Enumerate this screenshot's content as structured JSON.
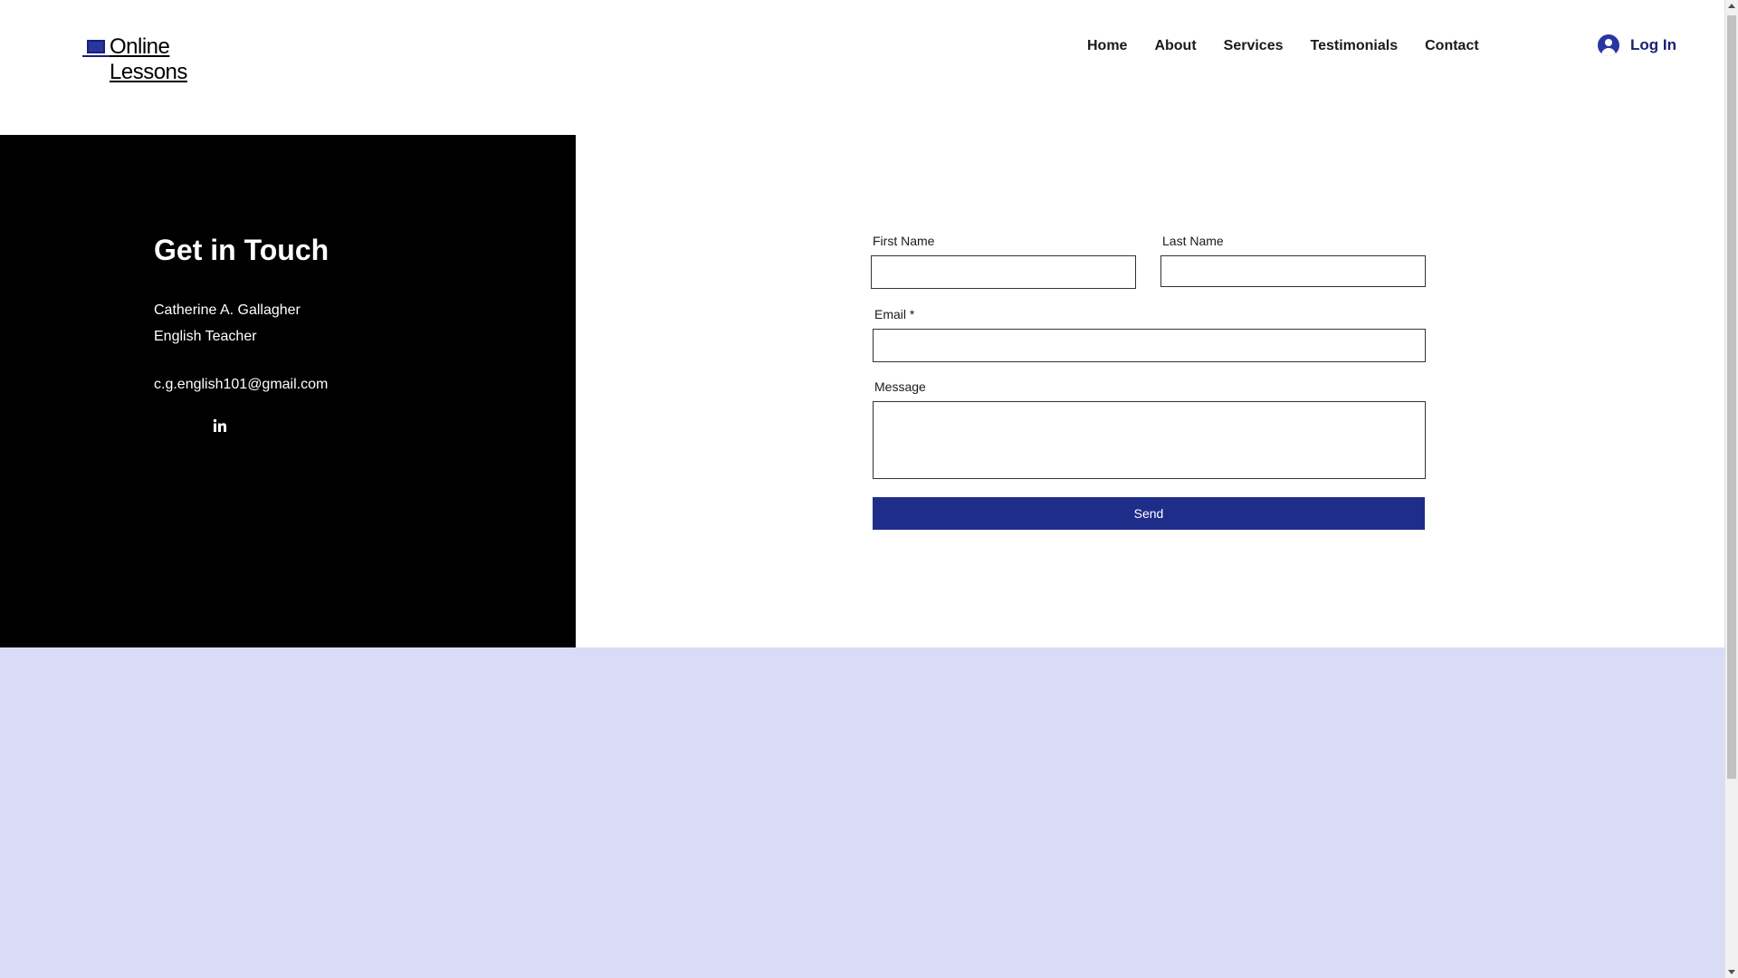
{
  "header": {
    "logo_text": "Online Lessons",
    "logo_icon": "laptop-icon",
    "nav": [
      {
        "label": "Home"
      },
      {
        "label": "About"
      },
      {
        "label": "Services"
      },
      {
        "label": "Testimonials"
      },
      {
        "label": "Contact"
      }
    ],
    "login_label": "Log In",
    "login_icon": "user-avatar-icon"
  },
  "contact": {
    "title": "Get in Touch",
    "name": "Catherine A. Gallagher",
    "role": "English Teacher",
    "email": "c.g.english101@gmail.com",
    "social_icon": "linkedin-icon"
  },
  "form": {
    "first_name_label": "First Name",
    "first_name_value": "",
    "last_name_label": "Last Name",
    "last_name_value": "",
    "email_label": "Email *",
    "email_value": "",
    "message_label": "Message",
    "message_value": "",
    "send_label": "Send"
  },
  "colors": {
    "accent": "#1f2d8a",
    "dark_panel": "#000000",
    "lavender_band": "#dadcf5",
    "background": "#ffffff"
  }
}
